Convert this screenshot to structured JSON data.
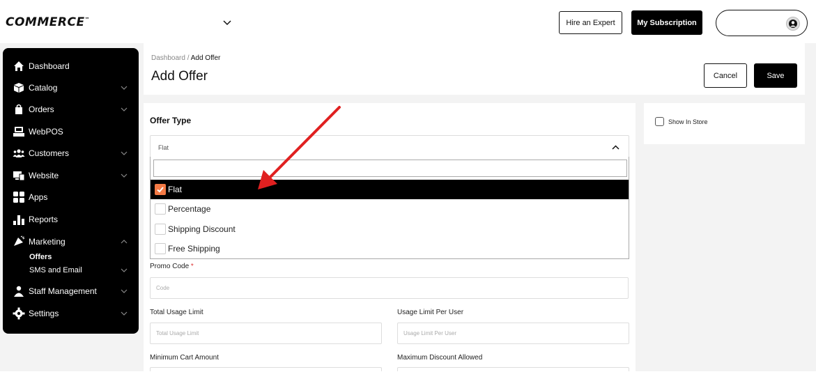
{
  "brand": {
    "logo_text": "COMMERCE",
    "trademark": "™"
  },
  "topbar": {
    "hire_label": "Hire an Expert",
    "subscription_label": "My Subscription"
  },
  "sidebar": {
    "items": [
      {
        "label": "Dashboard",
        "icon": "home-icon",
        "expandable": false
      },
      {
        "label": "Catalog",
        "icon": "box-icon",
        "expandable": true
      },
      {
        "label": "Orders",
        "icon": "bag-icon",
        "expandable": true
      },
      {
        "label": "WebPOS",
        "icon": "register-icon",
        "expandable": false
      },
      {
        "label": "Customers",
        "icon": "users-icon",
        "expandable": true
      },
      {
        "label": "Website",
        "icon": "monitor-icon",
        "expandable": true
      },
      {
        "label": "Apps",
        "icon": "apps-icon",
        "expandable": false
      },
      {
        "label": "Reports",
        "icon": "chart-icon",
        "expandable": false
      },
      {
        "label": "Marketing",
        "icon": "megaphone-icon",
        "expandable": true,
        "expanded": true
      },
      {
        "label": "Staff Management",
        "icon": "staff-icon",
        "expandable": true
      },
      {
        "label": "Settings",
        "icon": "gear-icon",
        "expandable": true
      }
    ],
    "marketing_sub": [
      {
        "label": "Offers",
        "active": true
      },
      {
        "label": "SMS and Email",
        "active": false,
        "expandable": true
      }
    ]
  },
  "header": {
    "breadcrumb_root": "Dashboard",
    "breadcrumb_sep": " / ",
    "breadcrumb_current": "Add Offer",
    "title": "Add Offer",
    "cancel_label": "Cancel",
    "save_label": "Save"
  },
  "form": {
    "offer_type_label": "Offer Type",
    "offer_type_value": "Flat",
    "dropdown_search_value": "",
    "options": [
      {
        "label": "Flat",
        "selected": true
      },
      {
        "label": "Percentage",
        "selected": false
      },
      {
        "label": "Shipping Discount",
        "selected": false
      },
      {
        "label": "Free Shipping",
        "selected": false
      }
    ],
    "promo_code_label": "Promo Code",
    "required_mark": "*",
    "promo_code_placeholder": "Code",
    "total_usage_label": "Total Usage Limit",
    "total_usage_placeholder": "Total Usage Limit",
    "per_user_label": "Usage Limit Per User",
    "per_user_placeholder": "Usage Limit Per User",
    "min_cart_label": "Minimum Cart Amount",
    "max_discount_label": "Maximum Discount Allowed"
  },
  "side_panel": {
    "show_in_store_label": "Show In Store",
    "show_in_store_checked": false
  },
  "colors": {
    "accent": "#f47a45",
    "annotation_arrow": "#e02020",
    "dark": "#000000"
  }
}
